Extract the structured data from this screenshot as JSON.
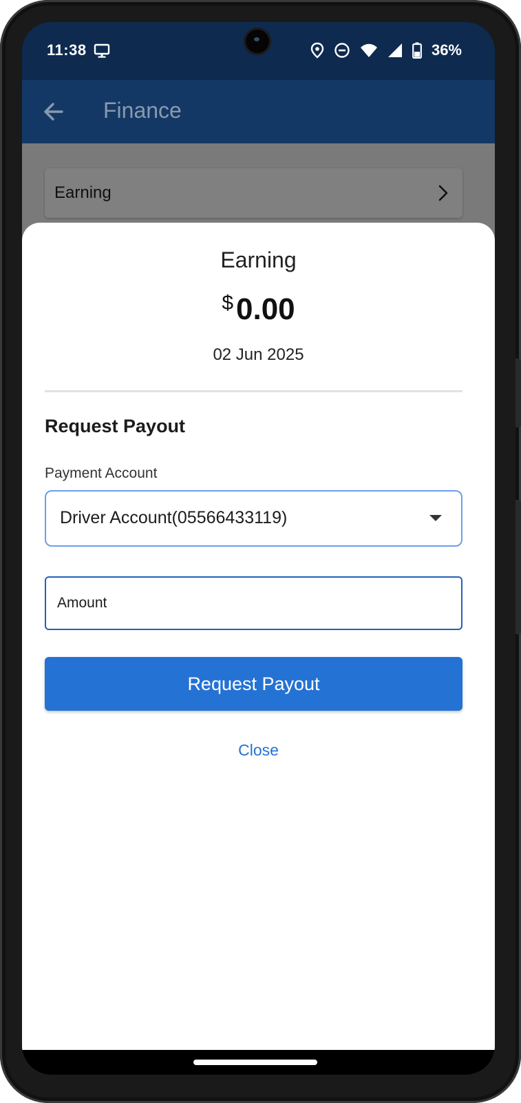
{
  "status_bar": {
    "time": "11:38",
    "battery": "36%",
    "icons": [
      "monitor-icon",
      "location-icon",
      "do-not-disturb-icon",
      "wifi-icon",
      "signal-icon",
      "battery-icon"
    ]
  },
  "app_bar": {
    "title": "Finance",
    "back_icon": "arrow-left-icon"
  },
  "background_list": {
    "earning_row_label": "Earning"
  },
  "sheet": {
    "title": "Earning",
    "currency": "$",
    "amount": "0.00",
    "date": "02 Jun 2025",
    "section_heading": "Request Payout",
    "payment_account_label": "Payment Account",
    "payment_account_value": "Driver Account(05566433119)",
    "amount_placeholder": "Amount",
    "request_button_label": "Request Payout",
    "close_label": "Close"
  },
  "colors": {
    "status_bar_bg": "#0e2a4f",
    "app_bar_bg": "#143866",
    "primary": "#2472d4",
    "select_border": "#6aa0e6",
    "input_border": "#2360b8"
  }
}
